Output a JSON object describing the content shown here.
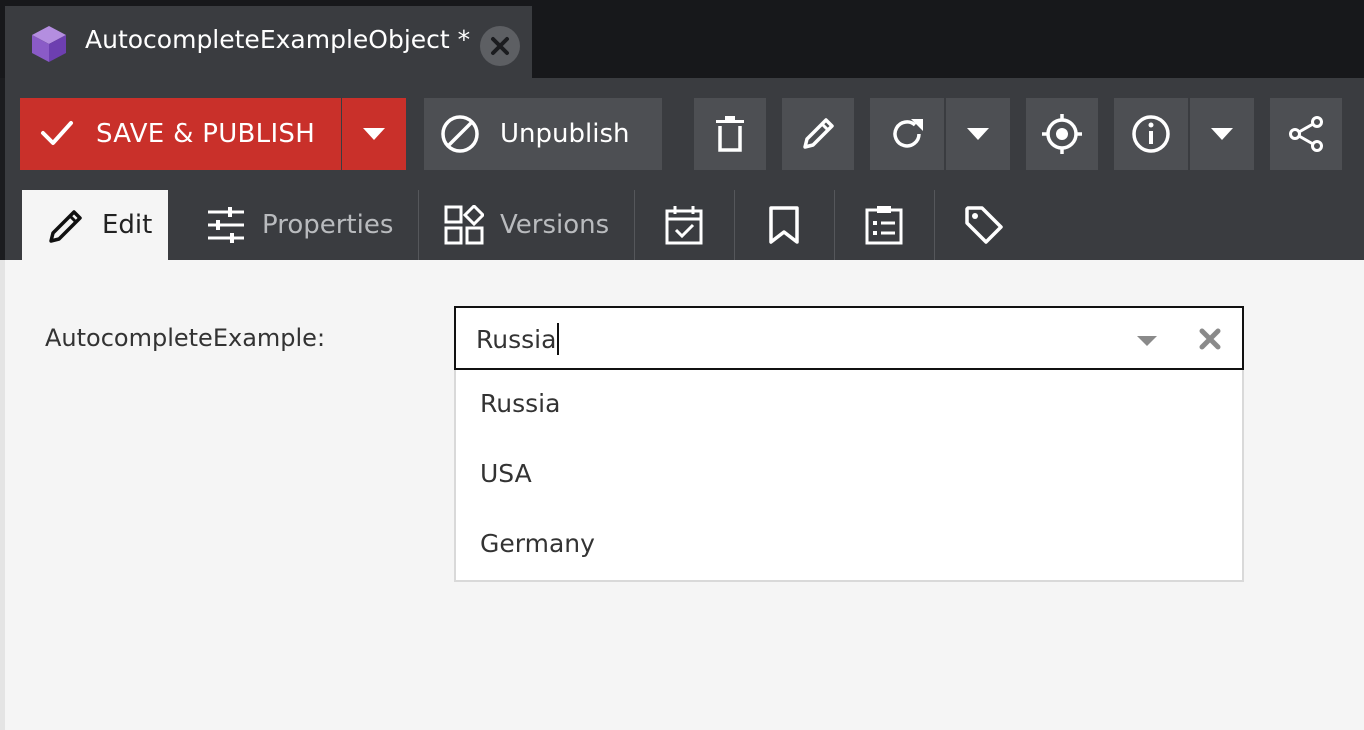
{
  "window_tab": {
    "title": "AutocompleteExampleObject *",
    "icon": "cube-icon",
    "close_icon": "close-icon"
  },
  "toolbar": {
    "save_publish_label": "SAVE & PUBLISH",
    "unpublish_label": "Unpublish",
    "icons": [
      "check-icon",
      "caret-down-icon",
      "unpublish-icon",
      "trash-icon",
      "pencil-icon",
      "reload-icon",
      "caret-down-icon",
      "target-icon",
      "info-icon",
      "caret-down-icon",
      "share-icon"
    ],
    "accent_color": "#c9302a"
  },
  "tabs": [
    {
      "label": "Edit",
      "icon": "pencil-icon",
      "active": true
    },
    {
      "label": "Properties",
      "icon": "sliders-icon",
      "active": false
    },
    {
      "label": "Versions",
      "icon": "shapes-icon",
      "active": false
    },
    {
      "label": "",
      "icon": "calendar-check-icon",
      "active": false
    },
    {
      "label": "",
      "icon": "bookmark-icon",
      "active": false
    },
    {
      "label": "",
      "icon": "clipboard-list-icon",
      "active": false
    },
    {
      "label": "",
      "icon": "tag-icon",
      "active": false
    }
  ],
  "form": {
    "field_label": "AutocompleteExample:",
    "input_value": "Russia",
    "options": [
      "Russia",
      "USA",
      "Germany"
    ]
  }
}
